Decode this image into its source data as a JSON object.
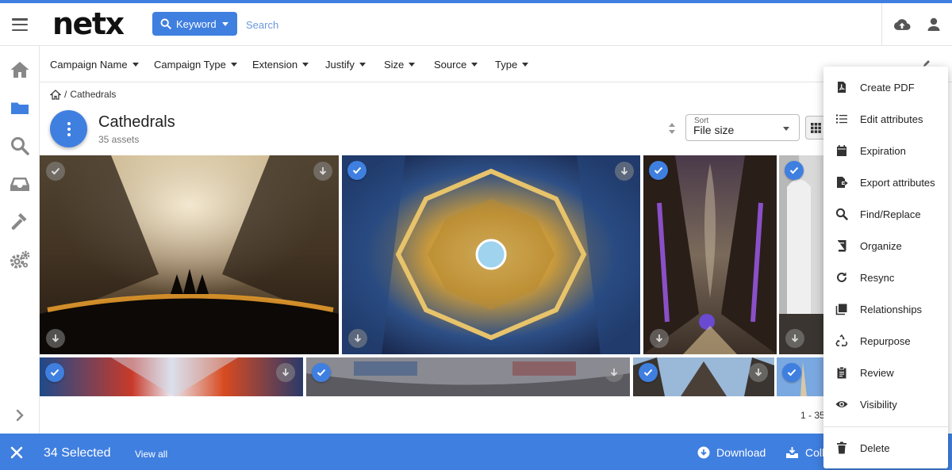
{
  "header": {
    "logo": "netx",
    "keyword_label": "Keyword",
    "search_placeholder": "Search"
  },
  "filters": [
    "Campaign Name",
    "Campaign Type",
    "Extension",
    "Justify",
    "Size",
    "Source",
    "Type"
  ],
  "breadcrumb": {
    "separator": "/",
    "current": "Cathedrals"
  },
  "folder": {
    "title": "Cathedrals",
    "count": "35 assets"
  },
  "sort": {
    "label": "Sort",
    "value": "File size"
  },
  "pagination": "1 - 35",
  "selection_bar": {
    "count": "34 Selected",
    "view_all": "View all",
    "download": "Download",
    "collection": "Coll"
  },
  "menu": {
    "items": [
      {
        "label": "Create PDF",
        "icon": "pdf-icon"
      },
      {
        "label": "Edit attributes",
        "icon": "list-icon"
      },
      {
        "label": "Expiration",
        "icon": "calendar-icon"
      },
      {
        "label": "Export attributes",
        "icon": "export-file-icon"
      },
      {
        "label": "Find/Replace",
        "icon": "search-icon"
      },
      {
        "label": "Organize",
        "icon": "book-icon"
      },
      {
        "label": "Resync",
        "icon": "refresh-icon"
      },
      {
        "label": "Relationships",
        "icon": "relationships-icon"
      },
      {
        "label": "Repurpose",
        "icon": "recycle-icon"
      },
      {
        "label": "Review",
        "icon": "clipboard-icon"
      },
      {
        "label": "Visibility",
        "icon": "eye-icon"
      }
    ],
    "delete_label": "Delete"
  },
  "colors": {
    "accent": "#3f7fe0",
    "text": "#212121"
  }
}
